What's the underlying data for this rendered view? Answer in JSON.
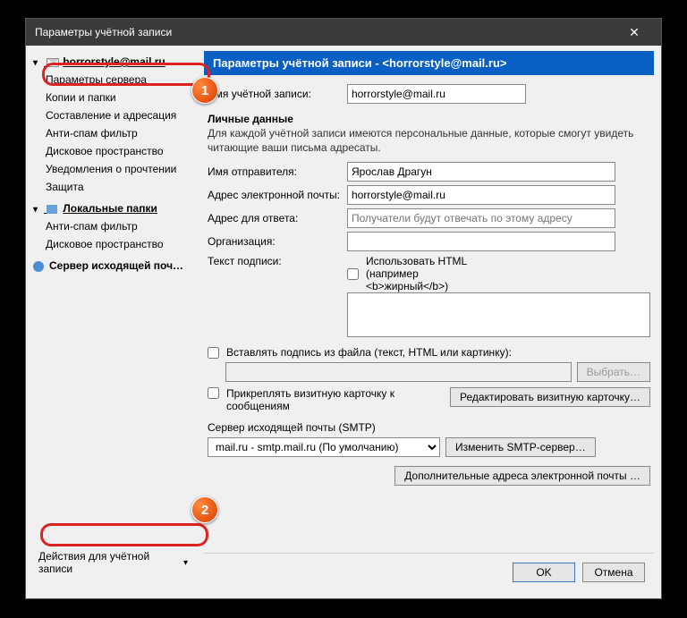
{
  "window": {
    "title": "Параметры учётной записи"
  },
  "sidebar": {
    "account": "horrorstyle@mail.ru",
    "items": [
      "Параметры сервера",
      "Копии и папки",
      "Составление и адресация",
      "Анти-спам фильтр",
      "Дисковое пространство",
      "Уведомления о прочтении",
      "Защита"
    ],
    "local_folders": "Локальные папки",
    "local_items": [
      "Анти-спам фильтр",
      "Дисковое пространство"
    ],
    "smtp": "Сервер исходящей поч…",
    "actions": "Действия для учётной записи"
  },
  "header": {
    "prefix": "Параметры учётной записи - ",
    "email": "<horrorstyle@mail.ru>"
  },
  "account_name": {
    "label": "Имя учётной записи:",
    "value": "horrorstyle@mail.ru"
  },
  "personal": {
    "heading": "Личные данные",
    "desc": "Для каждой учётной записи имеются персональные данные, которые смогут увидеть читающие ваши письма адресаты.",
    "sender_label": "Имя отправителя:",
    "sender_value": "Ярослав Драгун",
    "email_label": "Адрес электронной почты:",
    "email_value": "horrorstyle@mail.ru",
    "reply_label": "Адрес для ответа:",
    "reply_placeholder": "Получатели будут отвечать по этому адресу",
    "org_label": "Организация:",
    "sig_label": "Текст подписи:",
    "html_chk": "Использовать HTML (например <b>жирный</b>)",
    "file_chk": "Вставлять подпись из файла (текст, HTML или картинку):",
    "browse": "Выбрать…",
    "vcard_chk": "Прикреплять визитную карточку к сообщениям",
    "vcard_btn": "Редактировать визитную карточку…",
    "smtp_label": "Сервер исходящей почты (SMTP)",
    "smtp_value": "mail.ru - smtp.mail.ru (По умолчанию)",
    "smtp_btn": "Изменить SMTP-сервер…",
    "extra_btn": "Дополнительные адреса электронной почты …"
  },
  "buttons": {
    "ok": "OK",
    "cancel": "Отмена"
  },
  "steps": {
    "one": "1",
    "two": "2"
  }
}
